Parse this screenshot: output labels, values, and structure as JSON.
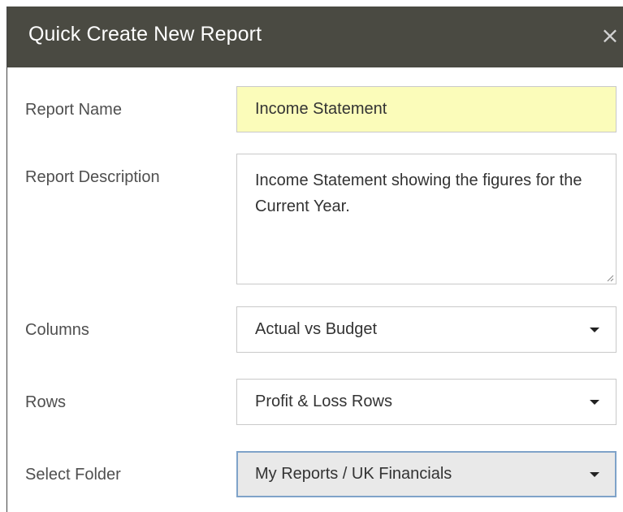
{
  "dialog": {
    "title": "Quick Create New Report",
    "close_glyph": "×"
  },
  "form": {
    "report_name_label": "Report Name",
    "report_name_value": "Income Statement",
    "report_description_label": "Report Description",
    "report_description_value": "Income Statement showing the figures for the Current Year.",
    "columns_label": "Columns",
    "columns_value": "Actual vs Budget",
    "rows_label": "Rows",
    "rows_value": "Profit & Loss Rows",
    "folder_label": "Select Folder",
    "folder_value": "My Reports / UK Financials"
  },
  "colors": {
    "titlebar": "#4a4a42",
    "name_field_highlight": "#fbfcba",
    "focused_select_border": "#7fa3c9"
  }
}
